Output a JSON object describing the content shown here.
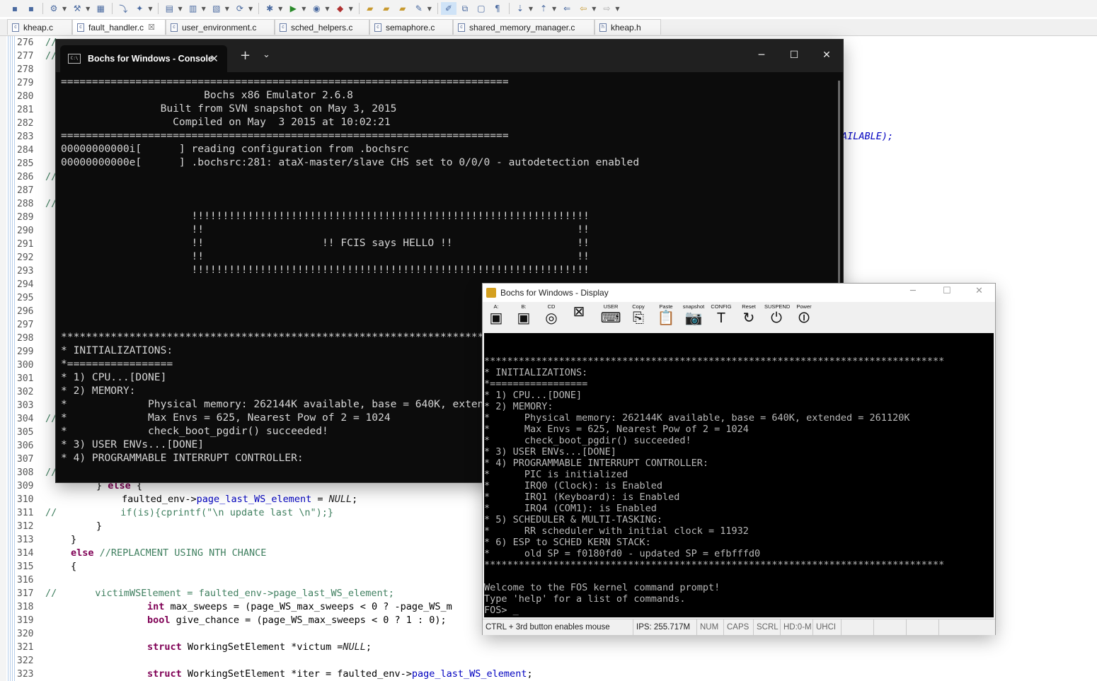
{
  "ide": {
    "tabs": [
      {
        "label": "kheap.c"
      },
      {
        "label": "fault_handler.c"
      },
      {
        "label": "user_environment.c"
      },
      {
        "label": "sched_helpers.c"
      },
      {
        "label": "semaphore.c"
      },
      {
        "label": "shared_memory_manager.c"
      },
      {
        "label": "kheap.h"
      }
    ],
    "active_tab_close": "☒",
    "line_numbers": [
      "276",
      "277",
      "278",
      "279",
      "280",
      "281",
      "282",
      "283",
      "284",
      "285",
      "286",
      "287",
      "288",
      "289",
      "290",
      "291",
      "292",
      "293",
      "294",
      "295",
      "296",
      "297",
      "298",
      "299",
      "300",
      "301",
      "302",
      "303",
      "304",
      "305",
      "306",
      "307",
      "308",
      "309",
      "310",
      "311",
      "312",
      "313",
      "314",
      "315",
      "316",
      "317",
      "318",
      "319",
      "320",
      "321",
      "322",
      "323"
    ],
    "visible_code": {
      "l276": "//",
      "l277": "//",
      "l283_tail": "AILABLE);",
      "l286": "//",
      "l288": "//",
      "l304": "//",
      "l308": "//",
      "l309_a": "} ",
      "l309_kw": "else",
      "l309_b": " {",
      "l310_a": "faulted_env->",
      "l310_fld": "page_last_WS_element",
      "l310_b": " = ",
      "l310_it": "NULL",
      "l310_c": ";",
      "l311_cm": "//",
      "l311_code": "if(is){cprintf(\"\\n update last \\n\");}",
      "l312": "}",
      "l313": "}",
      "l314_kw": "else",
      "l314_cm": " //REPLACMENT USING NTH CHANCE",
      "l315": "{",
      "l317_cm": "//",
      "l317_code": "victimWSElement = faulted_env->page_last_WS_element;",
      "l318_kw": "int",
      "l318_code": " max_sweeps = (page_WS_max_sweeps < 0 ? -page_WS_m",
      "l319_kw": "bool",
      "l319_code": " give_chance = (page_WS_max_sweeps < 0 ? 1 : 0);",
      "l321_kw": "struct",
      "l321_code": " WorkingSetElement *victum =",
      "l321_it": "NULL",
      "l321_end": ";",
      "l323_kw": "struct",
      "l323_code": " WorkingSetElement *iter = faulted_env->",
      "l323_fld": "page_last_WS_element",
      "l323_end": ";"
    }
  },
  "console": {
    "title": "Bochs for Windows - Console",
    "tab_icon_text": "C:\\",
    "close_tab": "✕",
    "new_tab": "+",
    "dropdown": "⌄",
    "minimize": "─",
    "maximize": "☐",
    "close": "✕",
    "lines": [
      "========================================================================",
      "                       Bochs x86 Emulator 2.6.8",
      "                Built from SVN snapshot on May 3, 2015",
      "                  Compiled on May  3 2015 at 10:02:21",
      "========================================================================",
      "00000000000i[      ] reading configuration from .bochsrc",
      "00000000000e[      ] .bochsrc:281: ataX-master/slave CHS set to 0/0/0 - autodetection enabled",
      "",
      "",
      "",
      "                     !!!!!!!!!!!!!!!!!!!!!!!!!!!!!!!!!!!!!!!!!!!!!!!!!!!!!!!!!!!!!!!!",
      "                     !!                                                            !!",
      "                     !!                   !! FCIS says HELLO !!                    !!",
      "                     !!                                                            !!",
      "                     !!!!!!!!!!!!!!!!!!!!!!!!!!!!!!!!!!!!!!!!!!!!!!!!!!!!!!!!!!!!!!!!",
      "",
      "",
      "",
      "",
      "*******************************************************************************",
      "* INITIALIZATIONS:",
      "*=================",
      "* 1) CPU...[DONE]",
      "* 2) MEMORY:",
      "*             Physical memory: 262144K available, base = 640K, extended = 261120K",
      "*             Max Envs = 625, Nearest Pow of 2 = 1024",
      "*             check_boot_pgdir() succeeded!",
      "* 3) USER ENVs...[DONE]",
      "* 4) PROGRAMMABLE INTERRUPT CONTROLLER:"
    ]
  },
  "display": {
    "title": "Bochs for Windows - Display",
    "minimize": "─",
    "maximize": "☐",
    "close": "✕",
    "toolbar": [
      {
        "label": "A:",
        "glyph": "▣"
      },
      {
        "label": "B:",
        "glyph": "▣"
      },
      {
        "label": "CD",
        "glyph": "◎"
      },
      {
        "label": "",
        "glyph": "⊠"
      },
      {
        "label": "USER",
        "glyph": "⌨"
      },
      {
        "label": "Copy",
        "glyph": "⎘"
      },
      {
        "label": "Paste",
        "glyph": "📋"
      },
      {
        "label": "snapshot",
        "glyph": "📷"
      },
      {
        "label": "CONFIG",
        "glyph": "T"
      },
      {
        "label": "Reset",
        "glyph": "↻"
      },
      {
        "label": "SUSPEND",
        "glyph": "⏻"
      },
      {
        "label": "Power",
        "glyph": "⏼"
      }
    ],
    "screen_lines": [
      "",
      "",
      "********************************************************************************",
      "* INITIALIZATIONS:",
      "*=================",
      "* 1) CPU...[DONE]",
      "* 2) MEMORY:",
      "*      Physical memory: 262144K available, base = 640K, extended = 261120K",
      "*      Max Envs = 625, Nearest Pow of 2 = 1024",
      "*      check_boot_pgdir() succeeded!",
      "* 3) USER ENVs...[DONE]",
      "* 4) PROGRAMMABLE INTERRUPT CONTROLLER:",
      "*      PIC is initialized",
      "*      IRQ0 (Clock): is Enabled",
      "*      IRQ1 (Keyboard): is Enabled",
      "*      IRQ4 (COM1): is Enabled",
      "* 5) SCHEDULER & MULTI-TASKING:",
      "*      RR scheduler with initial clock = 11932",
      "* 6) ESP to SCHED KERN STACK:",
      "*      old SP = f0180fd0 - updated SP = efbfffd0",
      "********************************************************************************",
      "",
      "Welcome to the FOS kernel command prompt!",
      "Type 'help' for a list of commands.",
      "FOS> _"
    ],
    "status": {
      "mouse_hint": "CTRL + 3rd button enables mouse",
      "ips": "IPS: 255.717M",
      "num": "NUM",
      "caps": "CAPS",
      "scrl": "SCRL",
      "hd": "HD:0-M",
      "uhci": "UHCI"
    }
  }
}
